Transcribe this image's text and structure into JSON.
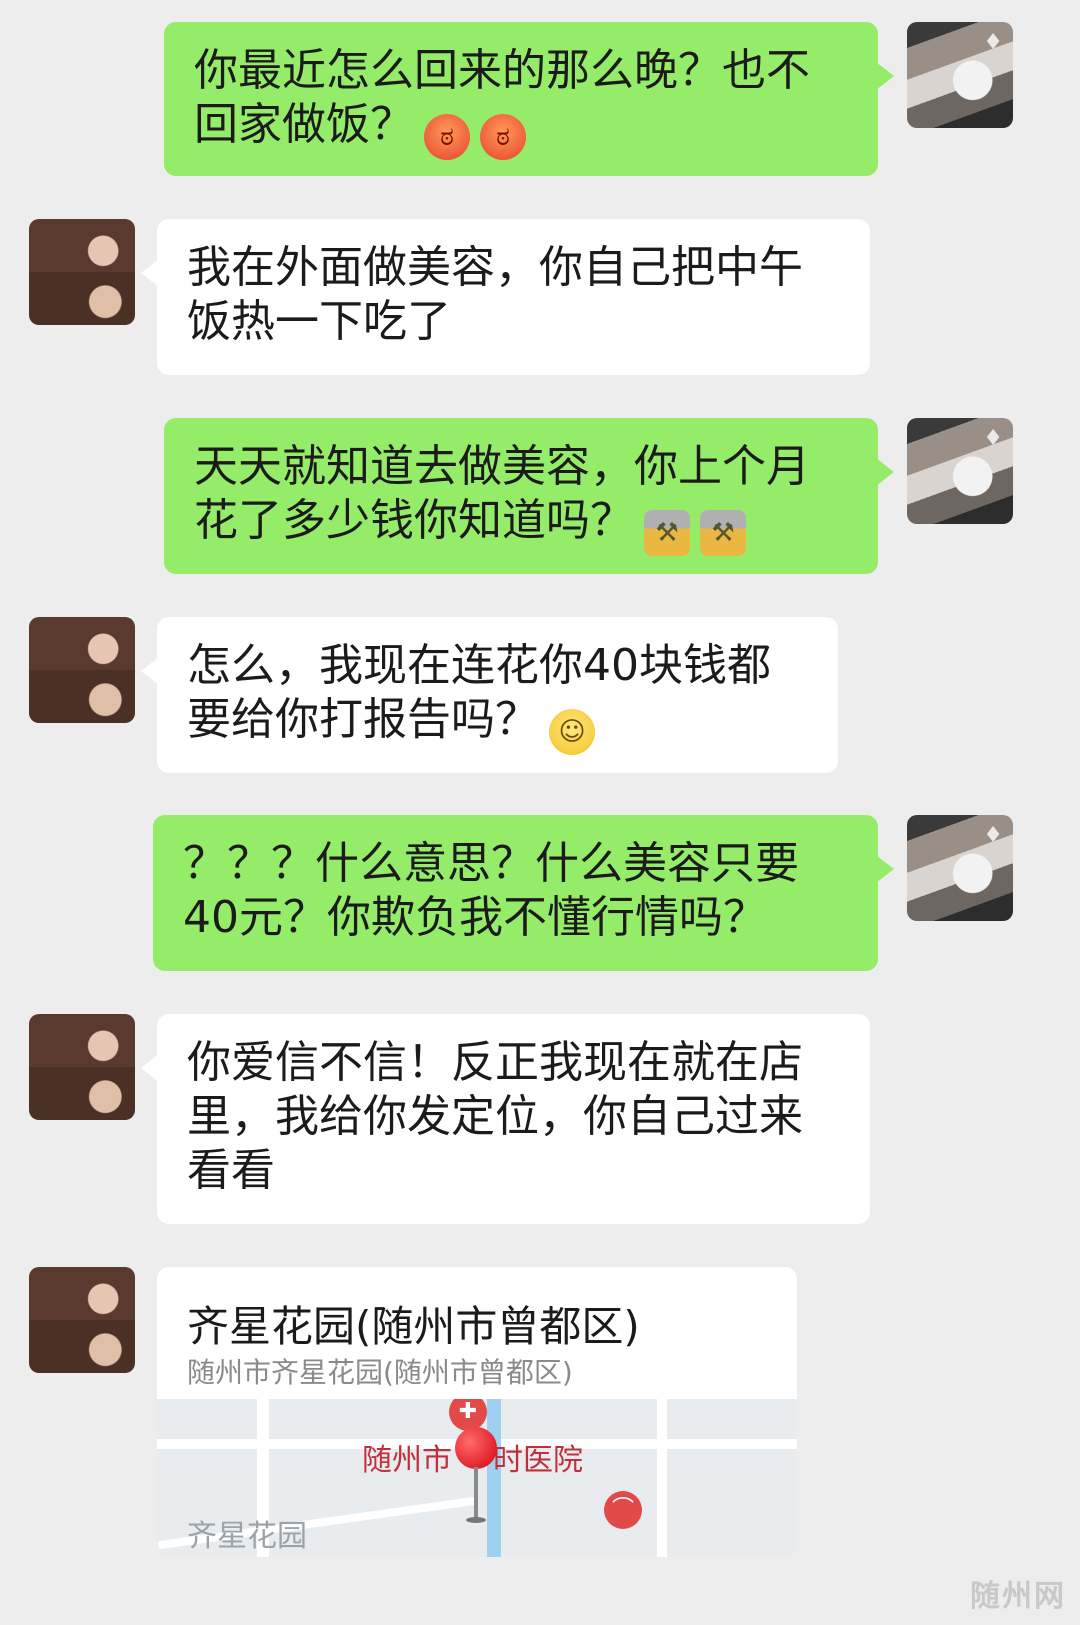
{
  "messages": [
    {
      "sender": "me",
      "text": "你最近怎么回来的那么晚？也不回家做饭？",
      "emoji": [
        "angry-face-emoji",
        "angry-face-emoji"
      ]
    },
    {
      "sender": "her",
      "text": "我在外面做美容，你自己把中午饭热一下吃了",
      "emoji": []
    },
    {
      "sender": "me",
      "text": "天天就知道去做美容，你上个月花了多少钱你知道吗？",
      "emoji": [
        "hammer-emoji",
        "hammer-emoji"
      ]
    },
    {
      "sender": "her",
      "text": "怎么，我现在连花你40块钱都要给你打报告吗？",
      "emoji": [
        "smile-emoji"
      ]
    },
    {
      "sender": "me",
      "text": "？？？什么意思？什么美容只要40元？你欺负我不懂行情吗？",
      "emoji": []
    },
    {
      "sender": "her",
      "text": "你爱信不信！反正我现在就在店里，我给你发定位，你自己过来看看",
      "emoji": []
    }
  ],
  "location_card": {
    "title": "齐星花园(随州市曾都区)",
    "address": "随州市齐星花园(随州市曾都区)",
    "map_labels": {
      "hospital": "随州市",
      "hospital_suffix": "时医院",
      "garden": "齐星花园"
    }
  },
  "watermark": "随州网",
  "colors": {
    "background": "#ededed",
    "my_bubble": "#95ec69",
    "her_bubble": "#ffffff"
  }
}
